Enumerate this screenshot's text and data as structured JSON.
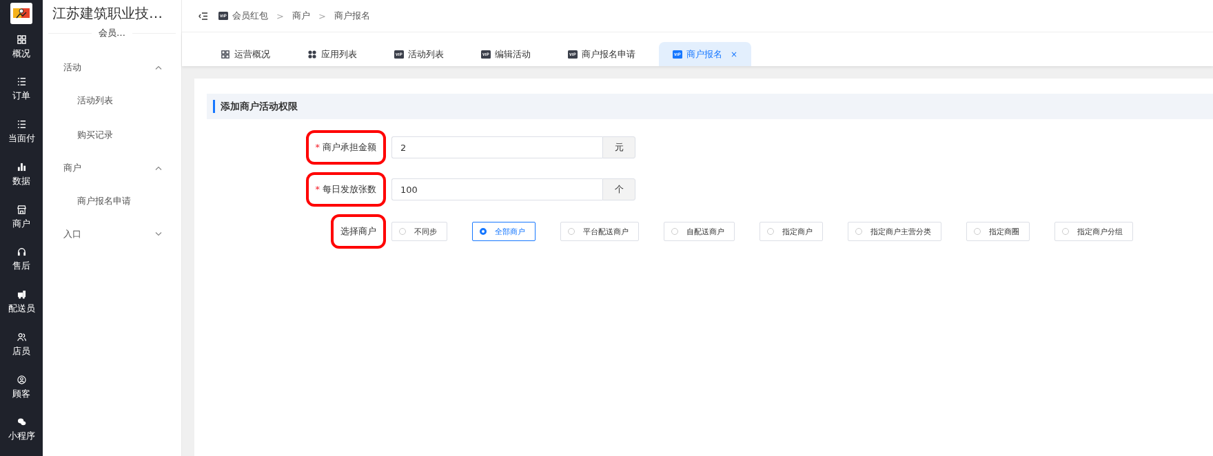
{
  "rail": {
    "items": [
      {
        "label": "概况",
        "kind": "grid"
      },
      {
        "label": "订单",
        "kind": "list"
      },
      {
        "label": "当面付",
        "kind": "list"
      },
      {
        "label": "数据",
        "kind": "bars"
      },
      {
        "label": "商户",
        "kind": "store"
      },
      {
        "label": "售后",
        "kind": "headset"
      },
      {
        "label": "配送员",
        "kind": "truck"
      },
      {
        "label": "店员",
        "kind": "people"
      },
      {
        "label": "顾客",
        "kind": "person"
      },
      {
        "label": "小程序",
        "kind": "chat"
      }
    ]
  },
  "sidebar": {
    "title": "江苏建筑职业技…",
    "subtitle": "会员…",
    "groups": [
      {
        "label": "活动",
        "expanded": true,
        "children": [
          {
            "label": "活动列表"
          },
          {
            "label": "购买记录"
          }
        ]
      },
      {
        "label": "商户",
        "expanded": true,
        "children": [
          {
            "label": "商户报名申请"
          }
        ]
      },
      {
        "label": "入口",
        "expanded": false
      }
    ]
  },
  "breadcrumb": [
    {
      "label": "会员红包",
      "kind": "vip"
    },
    {
      "separator": ">",
      "label": "商户"
    },
    {
      "separator": ">",
      "label": "商户报名"
    }
  ],
  "tabs": [
    {
      "label": "运营概况",
      "kind": "grid",
      "selected": false
    },
    {
      "label": "应用列表",
      "kind": "dots",
      "selected": false
    },
    {
      "label": "活动列表",
      "kind": "vip",
      "selected": false
    },
    {
      "label": "编辑活动",
      "kind": "vip",
      "selected": false
    },
    {
      "label": "商户报名申请",
      "kind": "vip",
      "selected": false
    },
    {
      "label": "商户报名",
      "kind": "vip",
      "selected": true,
      "close": "×"
    }
  ],
  "section": {
    "title": "添加商户活动权限"
  },
  "fields": [
    {
      "required_mark": "*",
      "label": "商户承担金额",
      "highlighted": true,
      "value": "2",
      "suffix": "元"
    },
    {
      "required_mark": "*",
      "label": "每日发放张数",
      "highlighted": true,
      "value": "100",
      "suffix": "个"
    }
  ],
  "merchant_select": {
    "label": "选择商户",
    "highlighted": true,
    "options": [
      {
        "label": "不同步",
        "selected": false
      },
      {
        "label": "全部商户",
        "selected": true
      },
      {
        "label": "平台配送商户",
        "selected": false
      },
      {
        "label": "自配送商户",
        "selected": false
      },
      {
        "label": "指定商户",
        "selected": false
      },
      {
        "label": "指定商户主营分类",
        "selected": false
      },
      {
        "label": "指定商圈",
        "selected": false
      },
      {
        "label": "指定商户分组",
        "selected": false
      }
    ]
  }
}
